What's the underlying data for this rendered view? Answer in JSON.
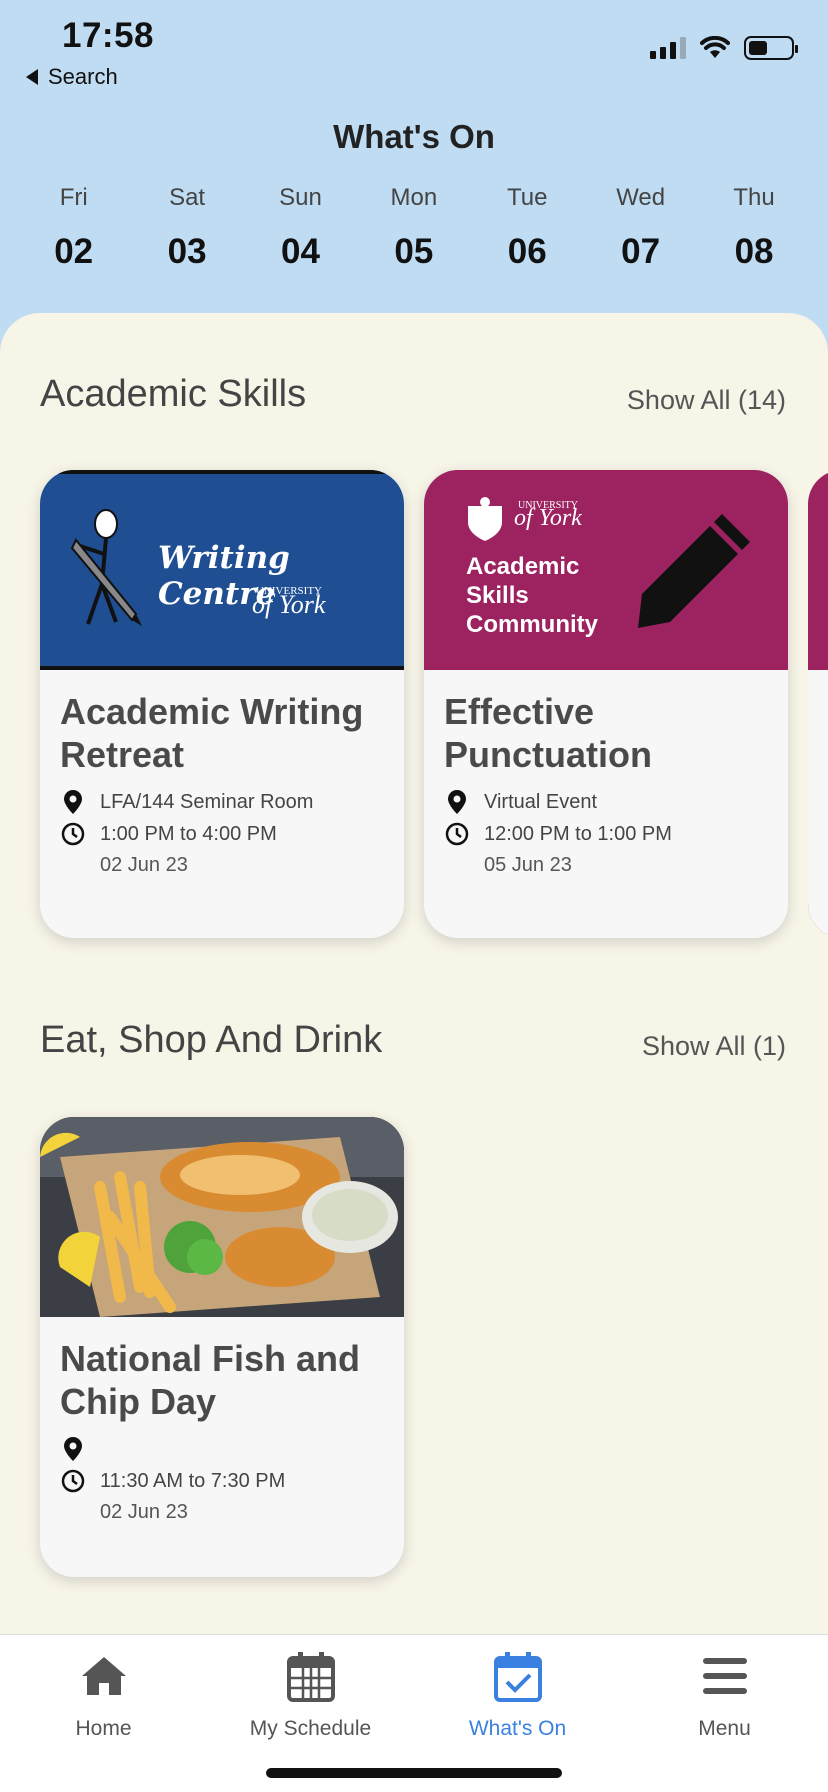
{
  "status": {
    "time": "17:58",
    "back_label": "Search"
  },
  "header": {
    "title": "What's On"
  },
  "days": [
    {
      "dow": "Fri",
      "num": "02"
    },
    {
      "dow": "Sat",
      "num": "03"
    },
    {
      "dow": "Sun",
      "num": "04"
    },
    {
      "dow": "Mon",
      "num": "05"
    },
    {
      "dow": "Tue",
      "num": "06"
    },
    {
      "dow": "Wed",
      "num": "07"
    },
    {
      "dow": "Thu",
      "num": "08"
    }
  ],
  "sections": [
    {
      "title": "Academic Skills",
      "show_all": "Show All (14)",
      "cards": [
        {
          "title": "Academic Writing Retreat",
          "location": "LFA/144 Seminar Room",
          "time": "1:00 PM to 4:00 PM",
          "date": "02 Jun 23",
          "banner": {
            "heading": "Writing Centre",
            "uni_small": "UNIVERSITY",
            "uni_name": "of York",
            "color": "#1f4e93"
          }
        },
        {
          "title": "Effective Punctuation",
          "location": "Virtual Event",
          "time": "12:00 PM to 1:00 PM",
          "date": "05 Jun 23",
          "banner": {
            "line1": "Academic",
            "line2": "Skills",
            "line3": "Community",
            "uni_small": "UNIVERSITY",
            "uni_name": "of York",
            "color": "#9c2360"
          }
        }
      ]
    },
    {
      "title": "Eat, Shop And Drink",
      "show_all": "Show All (1)",
      "cards": [
        {
          "title": "National Fish and Chip Day",
          "location": "",
          "time": "11:30 AM to 7:30 PM",
          "date": "02 Jun 23"
        }
      ]
    }
  ],
  "tabs": [
    {
      "label": "Home",
      "icon": "home-icon"
    },
    {
      "label": "My Schedule",
      "icon": "calendar-icon"
    },
    {
      "label": "What's On",
      "icon": "calendar-check-icon",
      "active": true
    },
    {
      "label": "Menu",
      "icon": "menu-icon"
    }
  ],
  "colors": {
    "header_bg": "#bfdcf3",
    "content_bg": "#f7f4e8",
    "accent": "#3a80e0"
  }
}
